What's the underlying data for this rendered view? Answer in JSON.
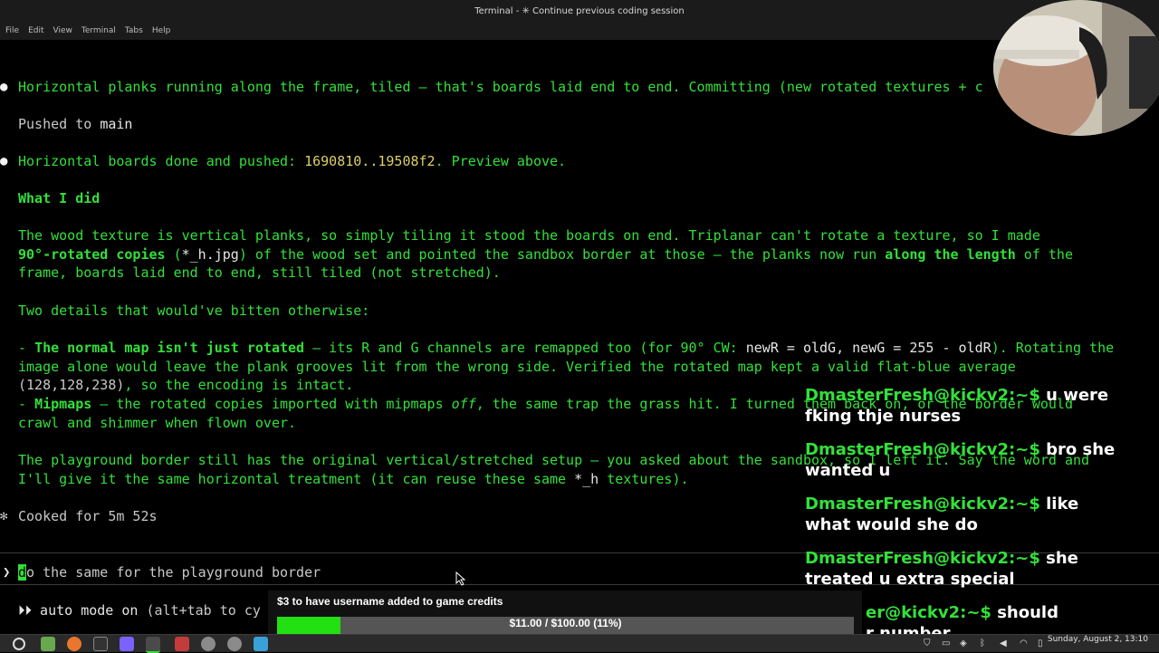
{
  "window": {
    "title": "Terminal - ✳ Continue previous coding session",
    "menu": [
      "File",
      "Edit",
      "View",
      "Terminal",
      "Tabs",
      "Help"
    ]
  },
  "terminal": {
    "line1": "Horizontal planks running along the frame, tiled — that's boards laid end to end. Committing (new rotated textures + c",
    "pushed_prefix": "Pushed to ",
    "pushed_branch": "main",
    "done_a": "Horizontal boards done and pushed: ",
    "done_hash": "1690810..19508f2",
    "done_b": ". Preview above.",
    "heading": "What I did",
    "p1_line1": "The wood texture is vertical planks, so simply tiling it stood the boards on end. Triplanar can't rotate a texture, so I made",
    "p1_bold1": "90°-rotated copies",
    "p1_mid1": " (",
    "p1_code1": "*_h.jpg",
    "p1_mid2": ") of the wood set and pointed the sandbox border at those — the planks now run ",
    "p1_bold2": "along the length",
    "p1_end": " of the",
    "p1_line3": "frame, boards laid end to end, still tiled (not stretched).",
    "p2": "Two details that would've bitten otherwise:",
    "bullet1_dash": "- ",
    "bullet1_bold": "The normal map isn't just rotated",
    "bullet1_a": " — its R and G channels are remapped too (for 90° CW: ",
    "bullet1_code": "newR = oldG, newG = 255 - oldR",
    "bullet1_b": "). Rotating the",
    "bullet1_line2": "image alone would leave the plank grooves lit from the wrong side. Verified the rotated map kept a valid flat-blue average",
    "bullet1_line3_code": "(128,128,238)",
    "bullet1_line3_rest": ", so the encoding is intact.",
    "bullet2_dash": "- ",
    "bullet2_bold": "Mipmaps",
    "bullet2_a": " — the rotated copies imported with mipmaps ",
    "bullet2_italic": "off",
    "bullet2_b": ", the same trap the grass hit. I turned them back on, or the border would",
    "bullet2_line2": "crawl and shimmer when flown over.",
    "p3_line1": "The playground border still has the original vertical/stretched setup — you asked about the sandbox, so I left it. Say the word and",
    "p3_line2_a": "I'll give it the same horizontal treatment (it can reuse these same ",
    "p3_line2_code": "*_h",
    "p3_line2_b": " textures).",
    "cooked_symbol": "✻",
    "cooked": "Cooked for 5m 52s",
    "prompt_symbol": "❯",
    "input_first": "d",
    "input_rest": "o the same for the playground border",
    "auto_symbol": "⏵⏵",
    "auto_mode": "auto mode on",
    "auto_hint": "(alt+tab to cy"
  },
  "chat_overlay": [
    {
      "user": "DmasterFresh@kickv2:~$",
      "msg1": " u were",
      "msg2": "fking thje nurses"
    },
    {
      "user": "DmasterFresh@kickv2:~$",
      "msg1": " bro she",
      "msg2": "wanted u"
    },
    {
      "user": "DmasterFresh@kickv2:~$",
      "msg1": " like",
      "msg2": "what would she do"
    },
    {
      "user": "DmasterFresh@kickv2:~$",
      "msg1": " she",
      "msg2": "treated u extra special"
    },
    {
      "user": "er@kickv2:~$",
      "msg1": " should",
      "msg2": "r number"
    }
  ],
  "donation": {
    "title": "$3 to have username added to game credits",
    "progress_text": "$11.00 / $100.00 (11%)",
    "progress_fraction": 0.11
  },
  "taskbar": {
    "clock": "Sunday, August  2, 13:10",
    "colors": {
      "firefox": "#e8762d",
      "files": "#6aa84f",
      "terminal": "#333333",
      "app": "#7b61ff"
    }
  },
  "colors": {
    "terminal_green": "#33e03a",
    "donation_fill": "#22e011",
    "background": "#000000"
  }
}
